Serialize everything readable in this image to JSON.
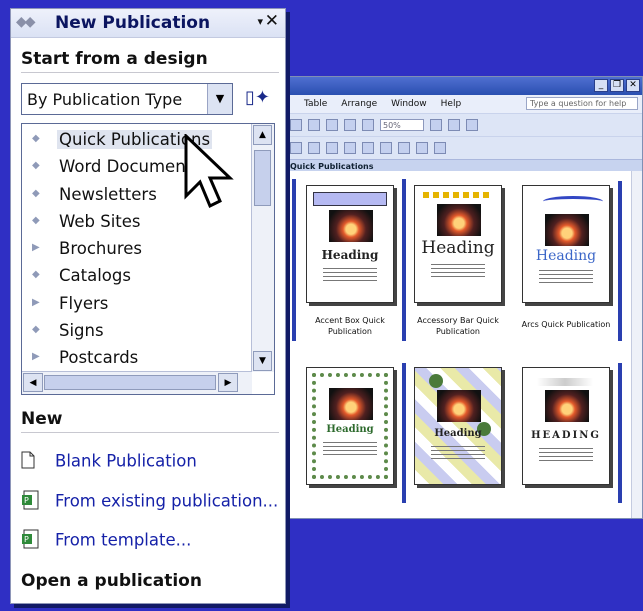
{
  "task_pane": {
    "title": "New Publication",
    "menu_arrow": "▾",
    "close": "✕",
    "start_section": "Start from a design",
    "type_select": {
      "value": "By Publication Type"
    },
    "publication_types": [
      {
        "label": "Quick Publications",
        "icon": "diamond-bullet-icon",
        "bullet": "◆",
        "selected": true
      },
      {
        "label": "Word Documents",
        "icon": "diamond-bullet-icon",
        "bullet": "◆",
        "selected": false
      },
      {
        "label": "Newsletters",
        "icon": "diamond-bullet-icon",
        "bullet": "◆",
        "selected": false
      },
      {
        "label": "Web Sites",
        "icon": "diamond-bullet-icon",
        "bullet": "◆",
        "selected": false
      },
      {
        "label": "Brochures",
        "icon": "expand-triangle-icon",
        "bullet": "▶",
        "selected": false
      },
      {
        "label": "Catalogs",
        "icon": "diamond-bullet-icon",
        "bullet": "◆",
        "selected": false
      },
      {
        "label": "Flyers",
        "icon": "expand-triangle-icon",
        "bullet": "▶",
        "selected": false
      },
      {
        "label": "Signs",
        "icon": "diamond-bullet-icon",
        "bullet": "◆",
        "selected": false
      },
      {
        "label": "Postcards",
        "icon": "expand-triangle-icon",
        "bullet": "▶",
        "selected": false
      }
    ],
    "new_section": "New",
    "new_links": [
      {
        "label": "Blank Publication",
        "icon": "blank-page-icon"
      },
      {
        "label": "From existing publication...",
        "icon": "publisher-file-icon"
      },
      {
        "label": "From template...",
        "icon": "publisher-file-icon"
      }
    ],
    "open_section": "Open a publication"
  },
  "publisher_window": {
    "menus": [
      "Table",
      "Arrange",
      "Window",
      "Help"
    ],
    "help_placeholder": "Type a question for help",
    "zoom": "50%",
    "gallery_title": "Quick Publications",
    "thumbnails": [
      {
        "heading": "Heading",
        "caption": "Accent Box Quick Publication"
      },
      {
        "heading": "Heading",
        "caption": "Accessory Bar Quick Publication"
      },
      {
        "heading": "Heading",
        "caption": "Arcs Quick Publication"
      },
      {
        "heading": "Heading",
        "caption": ""
      },
      {
        "heading": "Heading",
        "caption": ""
      },
      {
        "heading": "HEADING",
        "caption": ""
      }
    ]
  },
  "colors": {
    "desktop_background": "#2f2fc4",
    "link_color": "#1521a8",
    "pane_title_color": "#0b1560"
  }
}
